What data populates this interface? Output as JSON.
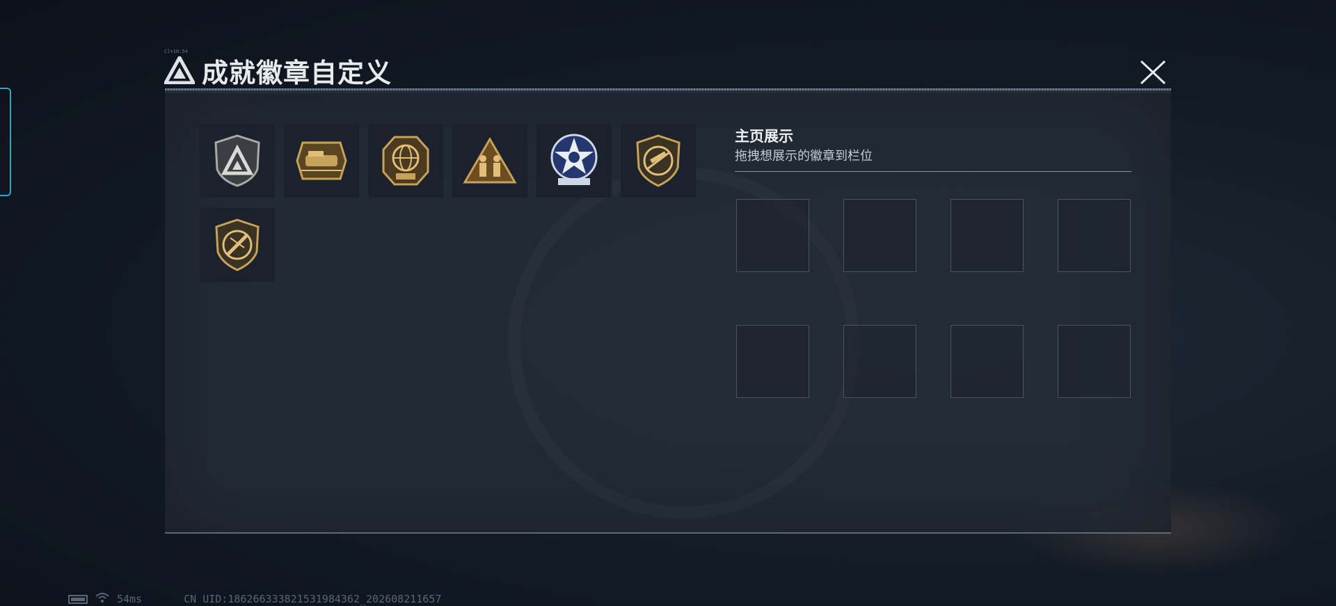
{
  "window": {
    "title": "成就徽章自定义",
    "tiny_caption": "Cl+10:54"
  },
  "badges": [
    {
      "name": "delta-logo-shield-badge",
      "style": "silver"
    },
    {
      "name": "delta-force-train-badge",
      "style": "gold"
    },
    {
      "name": "delta-force-2025-globe-badge",
      "style": "gold"
    },
    {
      "name": "soldiers-triangle-badge",
      "style": "gold"
    },
    {
      "name": "blue-star-badge",
      "style": "blue"
    },
    {
      "name": "rifle-shield-badge",
      "style": "gold"
    },
    {
      "name": "knife-shield-badge",
      "style": "gold"
    }
  ],
  "showcase": {
    "title": "主页展示",
    "subtitle": "拖拽想展示的徽章到栏位",
    "slot_count": 8
  },
  "status_bar": {
    "ping": "54ms",
    "uid": "CN UID:18626633382153198436​2_202608211657"
  },
  "colors": {
    "accent": "#2ea9c6",
    "gold": "#c8a25a",
    "panel": "#242c37"
  }
}
